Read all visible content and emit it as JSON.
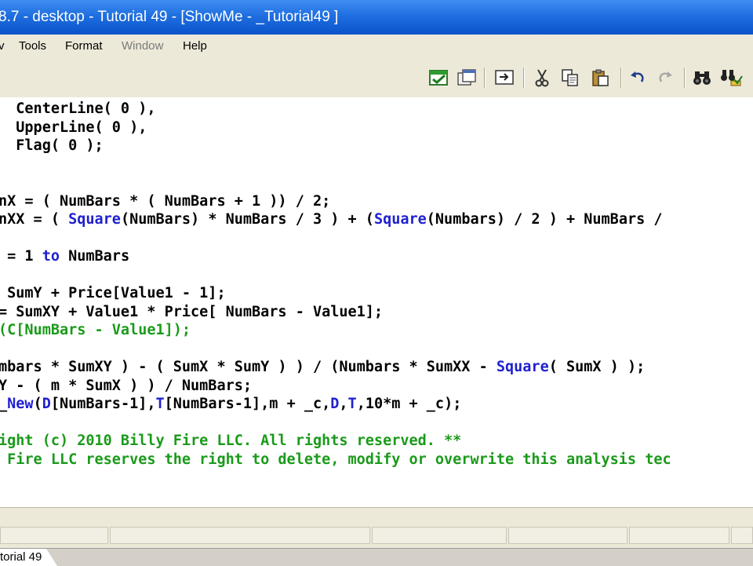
{
  "window": {
    "title": "8.7 - desktop - Tutorial 49 - [ShowMe - _Tutorial49 ]"
  },
  "menu": [
    {
      "label": "v",
      "enabled": true
    },
    {
      "label": "Tools",
      "enabled": true
    },
    {
      "label": "Format",
      "enabled": true
    },
    {
      "label": "Window",
      "enabled": false
    },
    {
      "label": "Help",
      "enabled": true
    }
  ],
  "toolbar": {
    "buttons": [
      {
        "icon": "verify-icon"
      },
      {
        "icon": "properties-icon"
      },
      {
        "icon": "insert-icon"
      },
      {
        "icon": "cut-icon"
      },
      {
        "icon": "copy-icon"
      },
      {
        "icon": "paste-icon"
      },
      {
        "icon": "undo-icon"
      },
      {
        "icon": "redo-icon"
      },
      {
        "icon": "find-icon"
      },
      {
        "icon": "find-replace-icon"
      }
    ]
  },
  "code": {
    "lines": [
      [
        {
          "t": "  CenterLine( 0 ),"
        }
      ],
      [
        {
          "t": "  UpperLine( 0 ),"
        }
      ],
      [
        {
          "t": "  Flag( 0 );"
        }
      ],
      [],
      [],
      [
        {
          "t": "nX = ( NumBars * ( NumBars + 1 )) / 2;"
        }
      ],
      [
        {
          "t": "nXX = ( "
        },
        {
          "t": "Square",
          "k": "kw"
        },
        {
          "t": "(NumBars) * NumBars / 3 ) + ("
        },
        {
          "t": "Square",
          "k": "kw"
        },
        {
          "t": "(Numbars) / 2 ) + NumBars / "
        }
      ],
      [],
      [
        {
          "t": " = 1 "
        },
        {
          "t": "to",
          "k": "kw"
        },
        {
          "t": " NumBars"
        }
      ],
      [],
      [
        {
          "t": " SumY + Price[Value1 - 1];"
        }
      ],
      [
        {
          "t": "= SumXY + Value1 * Price[ NumBars - Value1];"
        }
      ],
      [
        {
          "t": "(C[NumBars - Value1]);",
          "k": "cm"
        }
      ],
      [],
      [
        {
          "t": "mbars * SumXY ) - ( SumX * SumY ) ) / (Numbars * SumXX - "
        },
        {
          "t": "Square",
          "k": "kw"
        },
        {
          "t": "( SumX ) );"
        }
      ],
      [
        {
          "t": "Y - ( m * SumX ) ) / NumBars;"
        }
      ],
      [
        {
          "t": "_"
        },
        {
          "t": "New",
          "k": "kw"
        },
        {
          "t": "("
        },
        {
          "t": "D",
          "k": "kw"
        },
        {
          "t": "[NumBars-1],"
        },
        {
          "t": "T",
          "k": "kw"
        },
        {
          "t": "[NumBars-1],m + _c,"
        },
        {
          "t": "D",
          "k": "kw"
        },
        {
          "t": ","
        },
        {
          "t": "T",
          "k": "kw"
        },
        {
          "t": ",10*m + _c);"
        }
      ],
      [],
      [
        {
          "t": "ight (c) 2010 Billy Fire LLC. All rights reserved. **",
          "k": "cm"
        }
      ],
      [
        {
          "t": " Fire LLC reserves the right to delete, modify or overwrite this analysis tec",
          "k": "cm"
        }
      ]
    ]
  },
  "tabs": [
    {
      "label": "torial 49",
      "active": true
    }
  ],
  "colors": {
    "keyword": "#2020d0",
    "comment": "#1a9a1a",
    "titlebar": "#1f6fe0",
    "chrome": "#ece9d8"
  }
}
